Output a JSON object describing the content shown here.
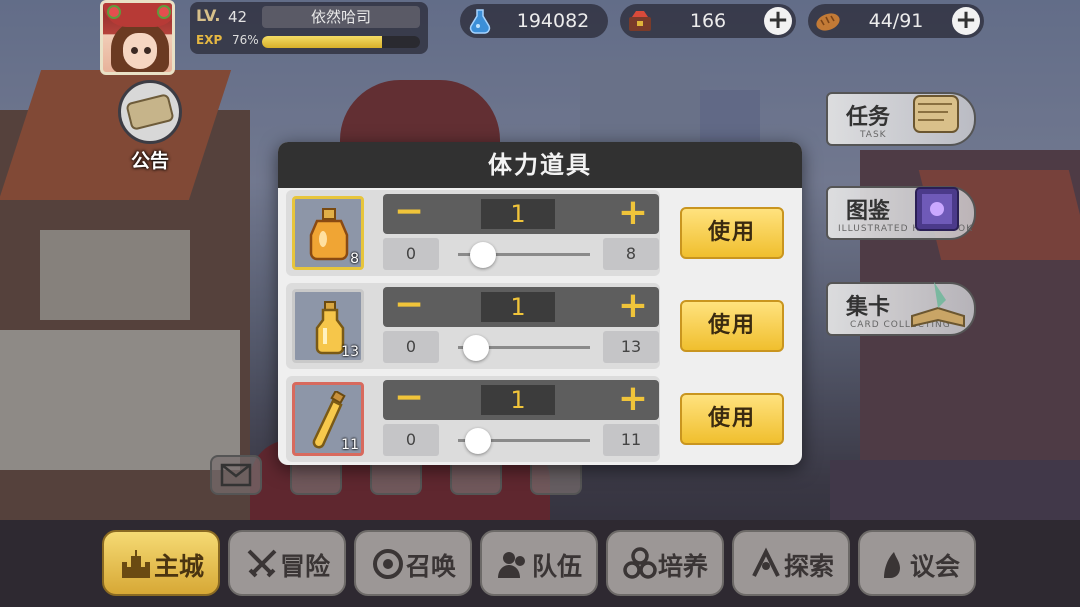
{
  "player": {
    "level_prefix": "LV.",
    "level": "42",
    "name": "依然哈司",
    "exp_label": "EXP",
    "exp_percent": "76%",
    "exp_fraction": 0.76
  },
  "resources": [
    {
      "icon": "blue-potion-icon",
      "value": "194082"
    },
    {
      "icon": "gem-chest-icon",
      "value": "166"
    },
    {
      "icon": "bread-icon",
      "value": "44/91"
    }
  ],
  "notice": {
    "label": "公告"
  },
  "side_menu": [
    {
      "zh": "任务",
      "en": "TASK"
    },
    {
      "zh": "图鉴",
      "en": "ILLUSTRATED HANDBOOK"
    },
    {
      "zh": "集卡",
      "en": "CARD COLLECTING"
    }
  ],
  "modal": {
    "title": "体力道具",
    "use_label": "使用",
    "items": [
      {
        "icon": "orange-potion-bottle-icon",
        "count": "8",
        "qty": "1",
        "min": "0",
        "max": "8",
        "slider_value": 1
      },
      {
        "icon": "yellow-vial-icon",
        "count": "13",
        "qty": "1",
        "min": "0",
        "max": "13",
        "slider_value": 1
      },
      {
        "icon": "yellow-test-tube-icon",
        "count": "11",
        "qty": "1",
        "min": "0",
        "max": "11",
        "slider_value": 1
      }
    ],
    "minus_symbol": "−",
    "plus_symbol": "+"
  },
  "bottom_nav": [
    {
      "label": "主城",
      "icon": "castle-icon",
      "active": true
    },
    {
      "label": "冒险",
      "icon": "crossed-swords-icon",
      "active": false
    },
    {
      "label": "召唤",
      "icon": "summon-circle-icon",
      "active": false
    },
    {
      "label": "队伍",
      "icon": "team-icon",
      "active": false
    },
    {
      "label": "培养",
      "icon": "train-icon",
      "active": false
    },
    {
      "label": "探索",
      "icon": "explore-icon",
      "active": false
    },
    {
      "label": "议会",
      "icon": "council-icon",
      "active": false
    }
  ],
  "colors": {
    "accent_gold": "#f0c43a",
    "modal_header": "#313131",
    "use_button": "#f0bf2e"
  }
}
